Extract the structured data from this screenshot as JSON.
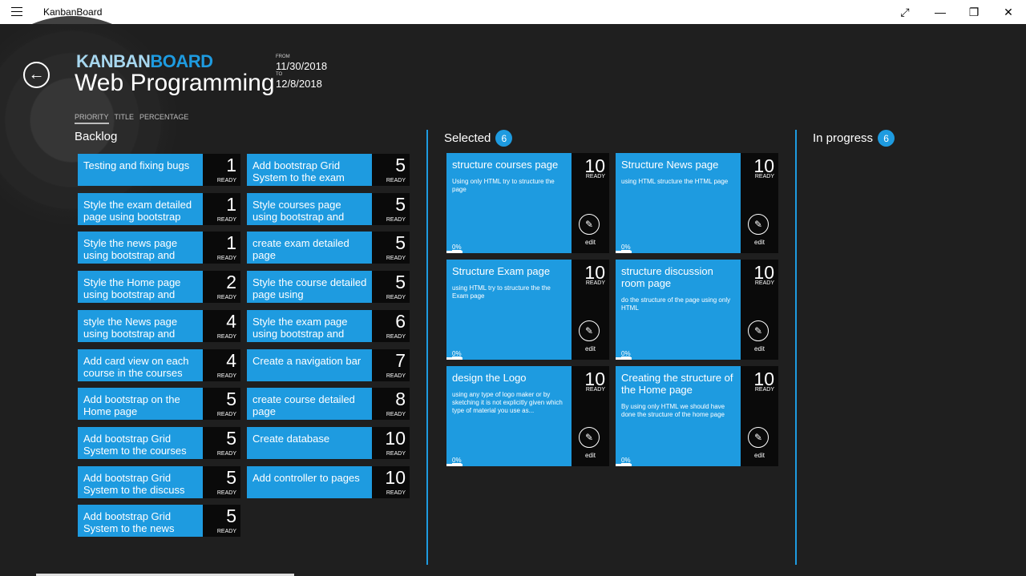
{
  "window": {
    "title": "KanbanBoard",
    "buttons": [
      "⤢",
      "—",
      "❐",
      "✕"
    ]
  },
  "header": {
    "brand_a": "KANBAN",
    "brand_b": "BOARD",
    "board_title": "Web Programming",
    "from_label": "FROM",
    "from_date": "11/30/2018",
    "to_label": "TO",
    "to_date": "12/8/2018"
  },
  "sort": [
    "PRIORITY",
    "TITLE",
    "PERCENTAGE"
  ],
  "columns": {
    "backlog": {
      "title": "Backlog"
    },
    "selected": {
      "title": "Selected",
      "count": "6"
    },
    "in_progress": {
      "title": "In progress",
      "count": "6"
    }
  },
  "backlog": [
    {
      "title": "Testing and fixing bugs",
      "points": "1",
      "status": "READY"
    },
    {
      "title": "Style the exam detailed page using bootstrap",
      "points": "1",
      "status": "READY"
    },
    {
      "title": "Style the news page using bootstrap and",
      "points": "1",
      "status": "READY"
    },
    {
      "title": "Style the Home page using bootstrap and",
      "points": "2",
      "status": "READY"
    },
    {
      "title": "style the News page using bootstrap and",
      "points": "4",
      "status": "READY"
    },
    {
      "title": "Add card view on each course in the courses",
      "points": "4",
      "status": "READY"
    },
    {
      "title": "Add bootstrap on the Home page",
      "points": "5",
      "status": "READY"
    },
    {
      "title": "Add bootstrap Grid System to the courses",
      "points": "5",
      "status": "READY"
    },
    {
      "title": "Add bootstrap Grid System to the discuss",
      "points": "5",
      "status": "READY"
    },
    {
      "title": "Add bootstrap Grid System to the news",
      "points": "5",
      "status": "READY"
    },
    {
      "title": "Add bootstrap Grid System to the exam",
      "points": "5",
      "status": "READY"
    },
    {
      "title": "Style courses page using bootstrap and",
      "points": "5",
      "status": "READY"
    },
    {
      "title": "create exam detailed page",
      "points": "5",
      "status": "READY"
    },
    {
      "title": "Style the course detailed page using",
      "points": "5",
      "status": "READY"
    },
    {
      "title": "Style the exam page using bootstrap and",
      "points": "6",
      "status": "READY"
    },
    {
      "title": "Create a navigation bar",
      "points": "7",
      "status": "READY"
    },
    {
      "title": "create course detailed page",
      "points": "8",
      "status": "READY"
    },
    {
      "title": "Create database",
      "points": "10",
      "status": "READY"
    },
    {
      "title": "Add controller to pages",
      "points": "10",
      "status": "READY"
    }
  ],
  "selected": [
    {
      "title": "structure courses page",
      "desc": "Using only HTML try to structure the page",
      "points": "10",
      "status": "READY",
      "progress": "0%",
      "edit": "edit"
    },
    {
      "title": "Structure News page",
      "desc": "using HTML structure the HTML page",
      "points": "10",
      "status": "READY",
      "progress": "0%",
      "edit": "edit"
    },
    {
      "title": "Structure Exam page",
      "desc": "using HTML try to structure the the Exam page",
      "points": "10",
      "status": "READY",
      "progress": "0%",
      "edit": "edit"
    },
    {
      "title": "structure discussion room page",
      "desc": "do the structure of the page using only HTML",
      "points": "10",
      "status": "READY",
      "progress": "0%",
      "edit": "edit"
    },
    {
      "title": "design the Logo",
      "desc": "using any type of logo maker or by sketching it is not explicitly given which type of material you use as...",
      "points": "10",
      "status": "READY",
      "progress": "0%",
      "edit": "edit"
    },
    {
      "title": "Creating the structure of the Home page",
      "desc": "By using only HTML we should have done the structure of the home page",
      "points": "10",
      "status": "READY",
      "progress": "0%",
      "edit": "edit"
    }
  ]
}
